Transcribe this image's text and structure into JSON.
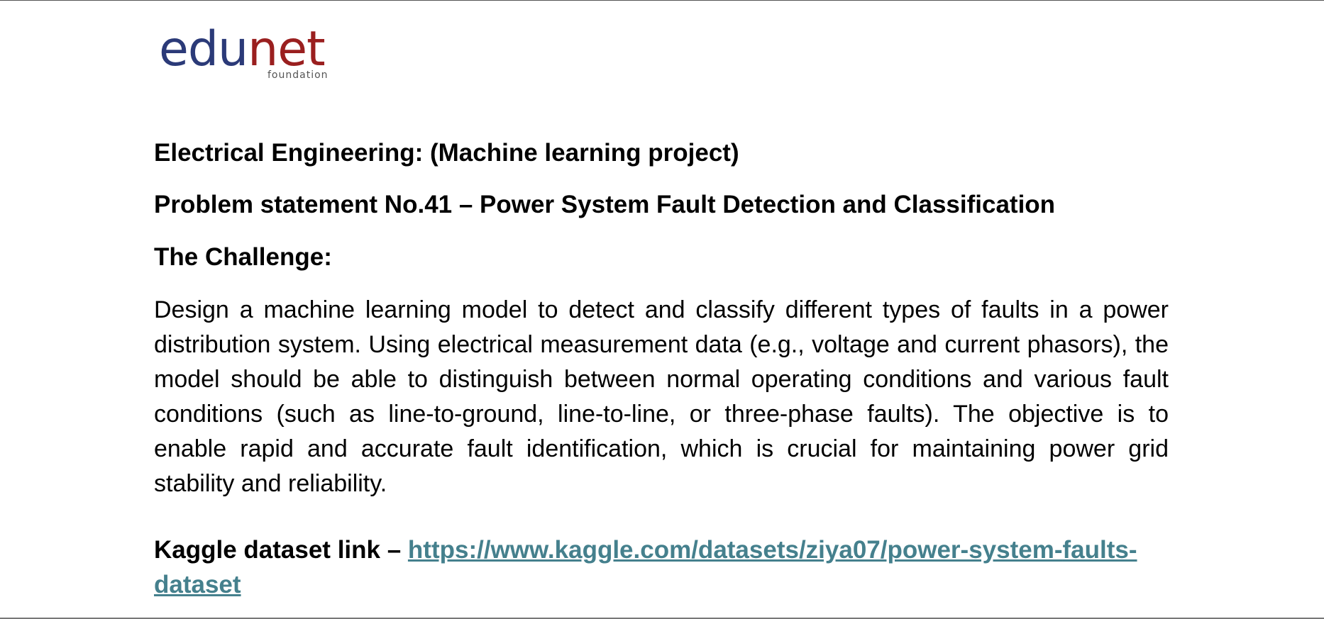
{
  "logo": {
    "part1": "edu",
    "part2": "net",
    "subtitle": "foundation",
    "colors": {
      "edu": "#2b3a78",
      "net": "#9a1f1f"
    }
  },
  "doc": {
    "heading1": "Electrical Engineering: (Machine learning project)",
    "heading2": "Problem statement No.41 – Power System Fault Detection and Classification",
    "heading3": "The Challenge:",
    "body": "Design a machine learning model to detect and classify different types of faults in a power distribution system. Using electrical measurement data (e.g., voltage and current phasors), the model should be able to distinguish between normal operating conditions and various fault conditions (such as line-to-ground, line-to-line, or three-phase faults). The objective is to enable rapid and accurate fault identification, which is crucial for maintaining power grid stability and reliability.",
    "kaggle_label": "Kaggle dataset link – ",
    "kaggle_url": "https://www.kaggle.com/datasets/ziya07/power-system-faults-dataset",
    "link_color": "#45808d"
  }
}
